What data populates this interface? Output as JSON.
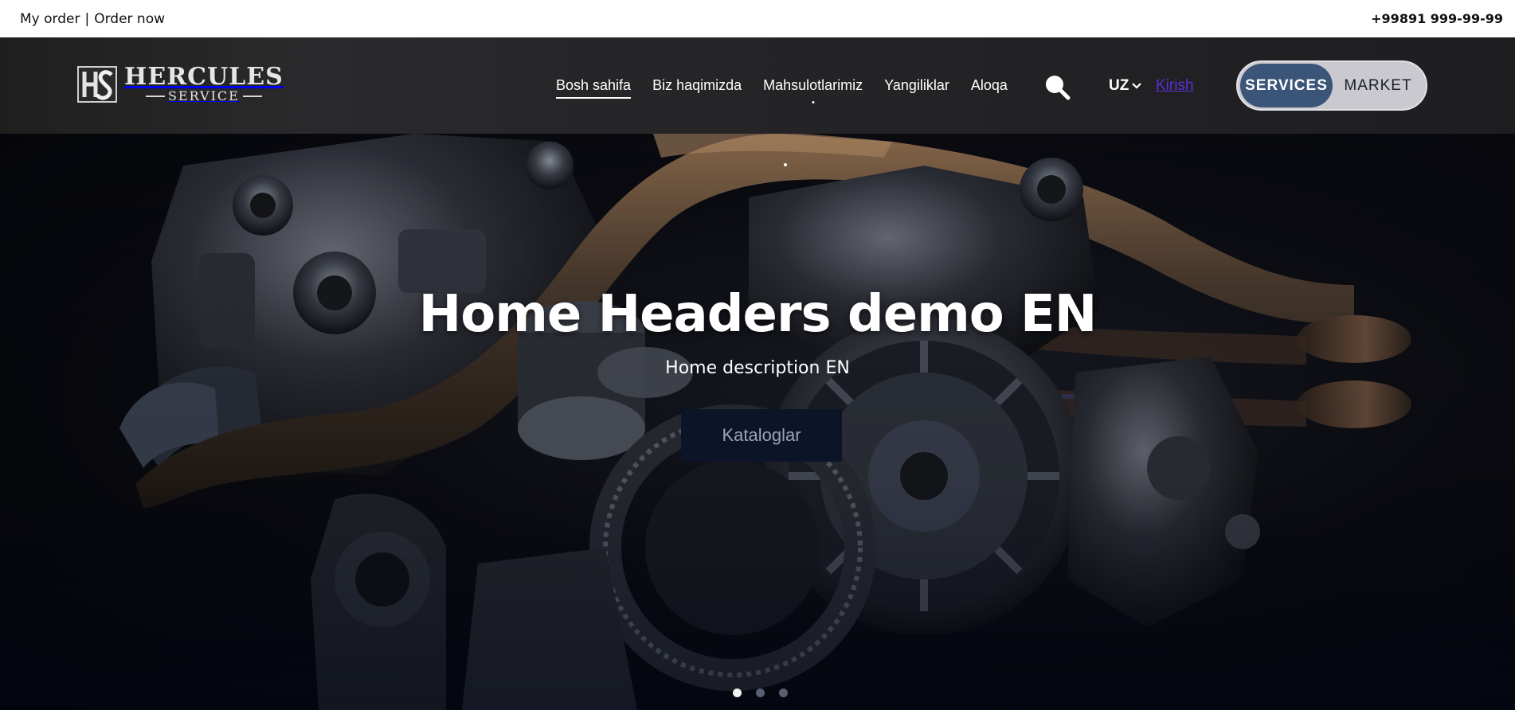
{
  "topbar": {
    "my_order": "My order",
    "separator": "|",
    "order_now": "Order now",
    "phone": "+99891 999-99-99"
  },
  "header": {
    "logo": {
      "line1": "HERCULES",
      "line2": "SERVICE",
      "mark": "HS"
    },
    "nav": [
      {
        "label": "Bosh sahifa",
        "active": true
      },
      {
        "label": "Biz haqimizda",
        "active": false
      },
      {
        "label": "Mahsulotlarimiz",
        "active": false
      },
      {
        "label": "Yangiliklar",
        "active": false
      },
      {
        "label": "Aloqa",
        "active": false
      }
    ],
    "search_icon": "search-icon",
    "language": "UZ",
    "login": "Kirish",
    "switch": {
      "services": "SERVICES",
      "market": "MARKET",
      "selected": "SERVICES"
    }
  },
  "hero": {
    "title": "Home Headers demo EN",
    "description": "Home description EN",
    "button": "Kataloglar",
    "slides_total": 3,
    "slide_active": 1
  },
  "colors": {
    "topbar_bg": "#ffffff",
    "header_bg": "#232325",
    "switch_active": "#3a5578",
    "login_link": "#5b2fd9",
    "hero_button_bg": "#0c1428"
  }
}
